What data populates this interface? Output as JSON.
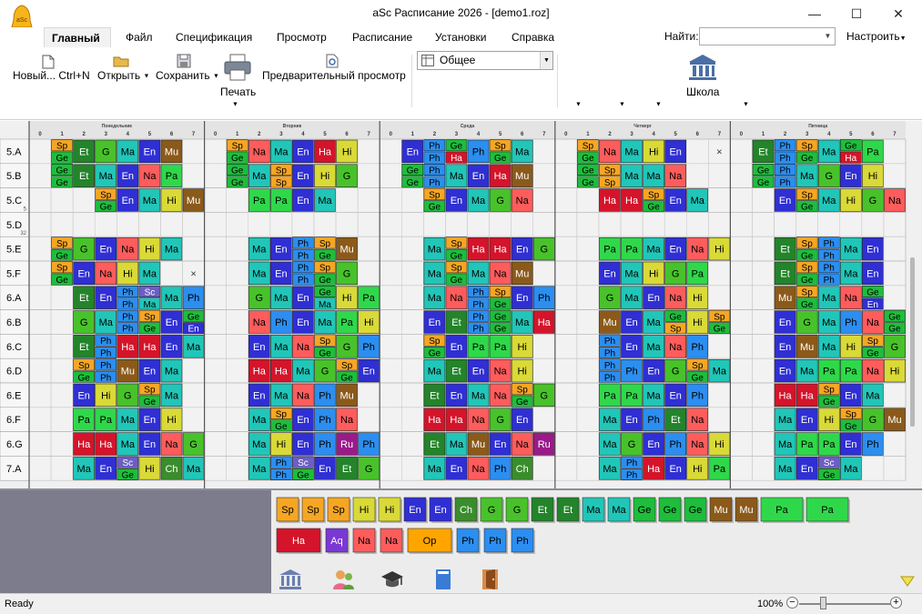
{
  "window": {
    "title": "aSc Расписание 2026  - [demo1.roz]",
    "app_icon_text": "aSc",
    "minimize": "—",
    "maximize": "☐",
    "close": "✕"
  },
  "menu": [
    {
      "label": "Главный",
      "active": true
    },
    {
      "label": "Файл"
    },
    {
      "label": "Спецификация"
    },
    {
      "label": "Просмотр"
    },
    {
      "label": "Расписание"
    },
    {
      "label": "Установки"
    },
    {
      "label": "Справка"
    }
  ],
  "find": {
    "label": "Найти:",
    "value": "",
    "dropdown": "▼"
  },
  "customize": {
    "label": "Настроить",
    "arrow": "▼"
  },
  "ribbon": {
    "new_label": "Новый... Ctrl+N",
    "open_label": "Открыть",
    "save_label": "Сохранить",
    "print_label": "Печать",
    "preview_label": "Предварительный просмотр",
    "view_select_value": "Общее",
    "school_label": "Школа",
    "dropdown_arrow": "▼"
  },
  "timetable": {
    "days": [
      "Понедельник",
      "Вторник",
      "Среда",
      "Четверг",
      "Пятница"
    ],
    "periods": [
      "0",
      "1",
      "2",
      "3",
      "4",
      "5",
      "6",
      "7"
    ],
    "classes": [
      {
        "name": "5.A"
      },
      {
        "name": "5.B"
      },
      {
        "name": "5.C",
        "sub": "5"
      },
      {
        "name": "5.D",
        "sub": "32"
      },
      {
        "name": "5.E"
      },
      {
        "name": "5.F"
      },
      {
        "name": "6.A"
      },
      {
        "name": "6.B"
      },
      {
        "name": "6.C"
      },
      {
        "name": "6.D"
      },
      {
        "name": "6.E"
      },
      {
        "name": "6.F"
      },
      {
        "name": "6.G"
      },
      {
        "name": "7.A"
      }
    ],
    "colors": {
      "Sp": "#f5a623",
      "Ge": "#1ebd3c",
      "Et": "#23842a",
      "Ma": "#21c6b8",
      "En": "#2f2fd4",
      "Mu": "#8b5a1a",
      "Hi": "#d9d937",
      "Na": "#ff5c5c",
      "Pa": "#2fd84a",
      "G": "#48c22a",
      "Ph": "#2b8ef0",
      "Ch": "#3a8d2c",
      "Ru": "#9a1a8a",
      "Ha": "#d4142a",
      "Sc": "#6c5ec4",
      "Op": "#ffa500",
      "Aq": "#7a38d4"
    },
    "mark_x": "×",
    "rows": [
      [
        [
          "Sp/Ge",
          "Et",
          "G",
          "Ma",
          "En",
          "Mu",
          ""
        ],
        [
          "Sp/Ge",
          "Na",
          "Ma",
          "En",
          "Ha",
          "Hi",
          ""
        ],
        [
          "En",
          "Ph/Ph",
          "Ge/Ha",
          "Ph",
          "Sp/Ge",
          "Ma",
          ""
        ],
        [
          "Sp/Ge",
          "Na",
          "Ma",
          "Hi",
          "En",
          "",
          "x"
        ],
        [
          "Et",
          "Ph/Ph",
          "Sp/Ge",
          "Ma",
          "Ge/Ha",
          "Pa",
          ""
        ]
      ],
      [
        [
          "Ge/Ge",
          "Et",
          "Ma",
          "En",
          "Na",
          "Pa",
          ""
        ],
        [
          "Ge/Ge",
          "Ma",
          "Sp/Sp",
          "En",
          "Hi",
          "G",
          ""
        ],
        [
          "Ge/Ge",
          "Ph/Ph",
          "Ma",
          "En",
          "Ha",
          "Mu",
          ""
        ],
        [
          "Ge/Ge",
          "Sp/Sp",
          "Ma",
          "Ma",
          "Na",
          "",
          ""
        ],
        [
          "Ge/Ge",
          "Ph/Ph",
          "Ma",
          "G",
          "En",
          "Hi",
          ""
        ]
      ],
      [
        [
          "",
          "",
          "Sp/Ge",
          "En",
          "Ma",
          "Hi",
          "Mu"
        ],
        [
          "",
          "Pa",
          "Pa",
          "En",
          "Ma",
          "",
          ""
        ],
        [
          "",
          "Sp/Ge",
          "En",
          "Ma",
          "G",
          "Na",
          ""
        ],
        [
          "",
          "Ha",
          "Ha",
          "Sp/Ge",
          "En",
          "Ma",
          ""
        ],
        [
          "",
          "En",
          "Sp/Ge",
          "Ma",
          "Hi",
          "G",
          "Na"
        ]
      ],
      [
        [
          "",
          "",
          "",
          "",
          "",
          "",
          ""
        ],
        [
          "",
          "",
          "",
          "",
          "",
          "",
          ""
        ],
        [
          "",
          "",
          "",
          "",
          "",
          "",
          ""
        ],
        [
          "",
          "",
          "",
          "",
          "",
          "",
          ""
        ],
        [
          "",
          "",
          "",
          "",
          "",
          "",
          ""
        ]
      ],
      [
        [
          "Sp/Ge",
          "G",
          "En",
          "Na",
          "Hi",
          "Ma",
          ""
        ],
        [
          "",
          "Ma",
          "En",
          "Ph/Ph",
          "Sp/Ge",
          "Mu",
          ""
        ],
        [
          "",
          "Ma",
          "Sp/Ge",
          "Ha",
          "Ha",
          "En",
          "G"
        ],
        [
          "",
          "Pa",
          "Pa",
          "Ma",
          "En",
          "Na",
          "Hi"
        ],
        [
          "",
          "Et",
          "Sp/Ge",
          "Ph/Ph",
          "Ma",
          "En",
          ""
        ]
      ],
      [
        [
          "Sp/Ge",
          "En",
          "Na",
          "Hi",
          "Ma",
          "",
          "x"
        ],
        [
          "",
          "Ma",
          "En",
          "Ph/Ph",
          "Sp/Ge",
          "G",
          ""
        ],
        [
          "",
          "Ma",
          "Sp/Ge",
          "Ma",
          "Na",
          "Mu",
          ""
        ],
        [
          "",
          "En",
          "Ma",
          "Hi",
          "G",
          "Pa",
          ""
        ],
        [
          "",
          "Et",
          "Sp/Ge",
          "Ph/Ph",
          "Ma",
          "En",
          ""
        ]
      ],
      [
        [
          "",
          "Et",
          "En",
          "Ph/Ph",
          "Sc/Ma",
          "Ma",
          "Ph"
        ],
        [
          "",
          "G",
          "Ma",
          "En",
          "Ge/Ma",
          "Hi",
          "Pa"
        ],
        [
          "",
          "Ma",
          "Na",
          "Ph/Ph",
          "Sp/Ge",
          "En",
          "Ph"
        ],
        [
          "",
          "G",
          "Ma",
          "En",
          "Na",
          "Hi",
          ""
        ],
        [
          "",
          "Mu",
          "Sp/Ge",
          "Ma",
          "Na",
          "Ge/En",
          ""
        ]
      ],
      [
        [
          "",
          "G",
          "Ma",
          "Ph/Ph",
          "Sp/Ge",
          "En",
          "Ge/En"
        ],
        [
          "",
          "Na",
          "Ph",
          "En",
          "Ma",
          "Pa",
          "Hi"
        ],
        [
          "",
          "En",
          "Et",
          "Ph/Ph",
          "Ge/Ge",
          "Ma",
          "Ha"
        ],
        [
          "",
          "Mu",
          "En",
          "Ma",
          "Ge/Sp",
          "Hi",
          "Sp/Ge"
        ],
        [
          "",
          "En",
          "G",
          "Ma",
          "Ph",
          "Na",
          "Ge/Ge"
        ]
      ],
      [
        [
          "",
          "Et",
          "Ph/Ph",
          "Ha",
          "Ha",
          "En",
          "Ma"
        ],
        [
          "",
          "En",
          "Ma",
          "Na",
          "Sp/Ge",
          "G",
          "Ph"
        ],
        [
          "",
          "Sp/Ge",
          "En",
          "Pa",
          "Pa",
          "Hi",
          ""
        ],
        [
          "",
          "Ph/Ph",
          "En",
          "Ma",
          "Na",
          "Ph",
          ""
        ],
        [
          "",
          "En",
          "Mu",
          "Ma",
          "Hi",
          "Sp/Ge",
          "G"
        ]
      ],
      [
        [
          "",
          "Sp/Ge",
          "Ph/Ph",
          "Mu",
          "En",
          "Ma",
          ""
        ],
        [
          "",
          "Ha",
          "Ha",
          "Ma",
          "G",
          "Sp/Ge",
          "En"
        ],
        [
          "",
          "Ma",
          "Et",
          "En",
          "Na",
          "Hi",
          ""
        ],
        [
          "",
          "Ph/Ph",
          "Ph",
          "En",
          "G",
          "Sp/Ge",
          "Ma"
        ],
        [
          "",
          "En",
          "Ma",
          "Pa",
          "Pa",
          "Na",
          "Hi"
        ]
      ],
      [
        [
          "",
          "En",
          "Hi",
          "G",
          "Sp/Ge",
          "Ma",
          ""
        ],
        [
          "",
          "En",
          "Ma",
          "Na",
          "Ph",
          "Mu",
          ""
        ],
        [
          "",
          "Et",
          "En",
          "Ma",
          "Na",
          "Sp/Ge",
          "G"
        ],
        [
          "",
          "Pa",
          "Pa",
          "Ma",
          "En",
          "Ph",
          ""
        ],
        [
          "",
          "Ha",
          "Ha",
          "Sp/Ge",
          "En",
          "Ma",
          ""
        ]
      ],
      [
        [
          "",
          "Pa",
          "Pa",
          "Ma",
          "En",
          "Hi",
          ""
        ],
        [
          "",
          "Ma",
          "Sp/Ge",
          "En",
          "Ph",
          "Na",
          ""
        ],
        [
          "",
          "Ha",
          "Ha",
          "Na",
          "G",
          "En",
          ""
        ],
        [
          "",
          "Ma",
          "En",
          "Ph",
          "Et",
          "Na",
          ""
        ],
        [
          "",
          "Ma",
          "En",
          "Hi",
          "Sp/Ge",
          "G",
          "Mu"
        ]
      ],
      [
        [
          "",
          "Ha",
          "Ha",
          "Ma",
          "En",
          "Na",
          "G"
        ],
        [
          "",
          "Ma",
          "Hi",
          "En",
          "Ph",
          "Ru",
          "Ph"
        ],
        [
          "",
          "Et",
          "Ma",
          "Mu",
          "En",
          "Na",
          "Ru"
        ],
        [
          "",
          "Ma",
          "G",
          "En",
          "Ph",
          "Na",
          "Hi"
        ],
        [
          "",
          "Ma",
          "Pa",
          "Pa",
          "En",
          "Ph",
          ""
        ]
      ],
      [
        [
          "",
          "Ma",
          "En",
          "Sc/Ge",
          "Hi",
          "Ch",
          "Ma"
        ],
        [
          "",
          "Ma",
          "Ph/Ph",
          "Sc/Ge",
          "En",
          "Et",
          "G"
        ],
        [
          "",
          "Ma",
          "En",
          "Na",
          "Ph",
          "Ch",
          ""
        ],
        [
          "",
          "Ma",
          "Ph/Ph",
          "Ha",
          "En",
          "Hi",
          "Pa"
        ],
        [
          "",
          "Ma",
          "En",
          "Sc/Ge",
          "Ma",
          "",
          ""
        ]
      ]
    ]
  },
  "palette": {
    "row1": [
      "Sp",
      "Sp",
      "Sp",
      "Hi",
      "Hi",
      "En",
      "En",
      "Ch",
      "G",
      "G",
      "Et",
      "Et",
      "Ma",
      "Ma",
      "Ge",
      "Ge",
      "Ge",
      "Mu",
      "Mu",
      "Pa",
      "Pa"
    ],
    "row2": [
      "Ha",
      "Aq",
      "Na",
      "Na",
      "Op",
      "Ph",
      "Ph",
      "Ph"
    ]
  },
  "status": {
    "text": "Ready",
    "zoom": "100%",
    "zoom_minus": "−",
    "zoom_plus": "+"
  }
}
